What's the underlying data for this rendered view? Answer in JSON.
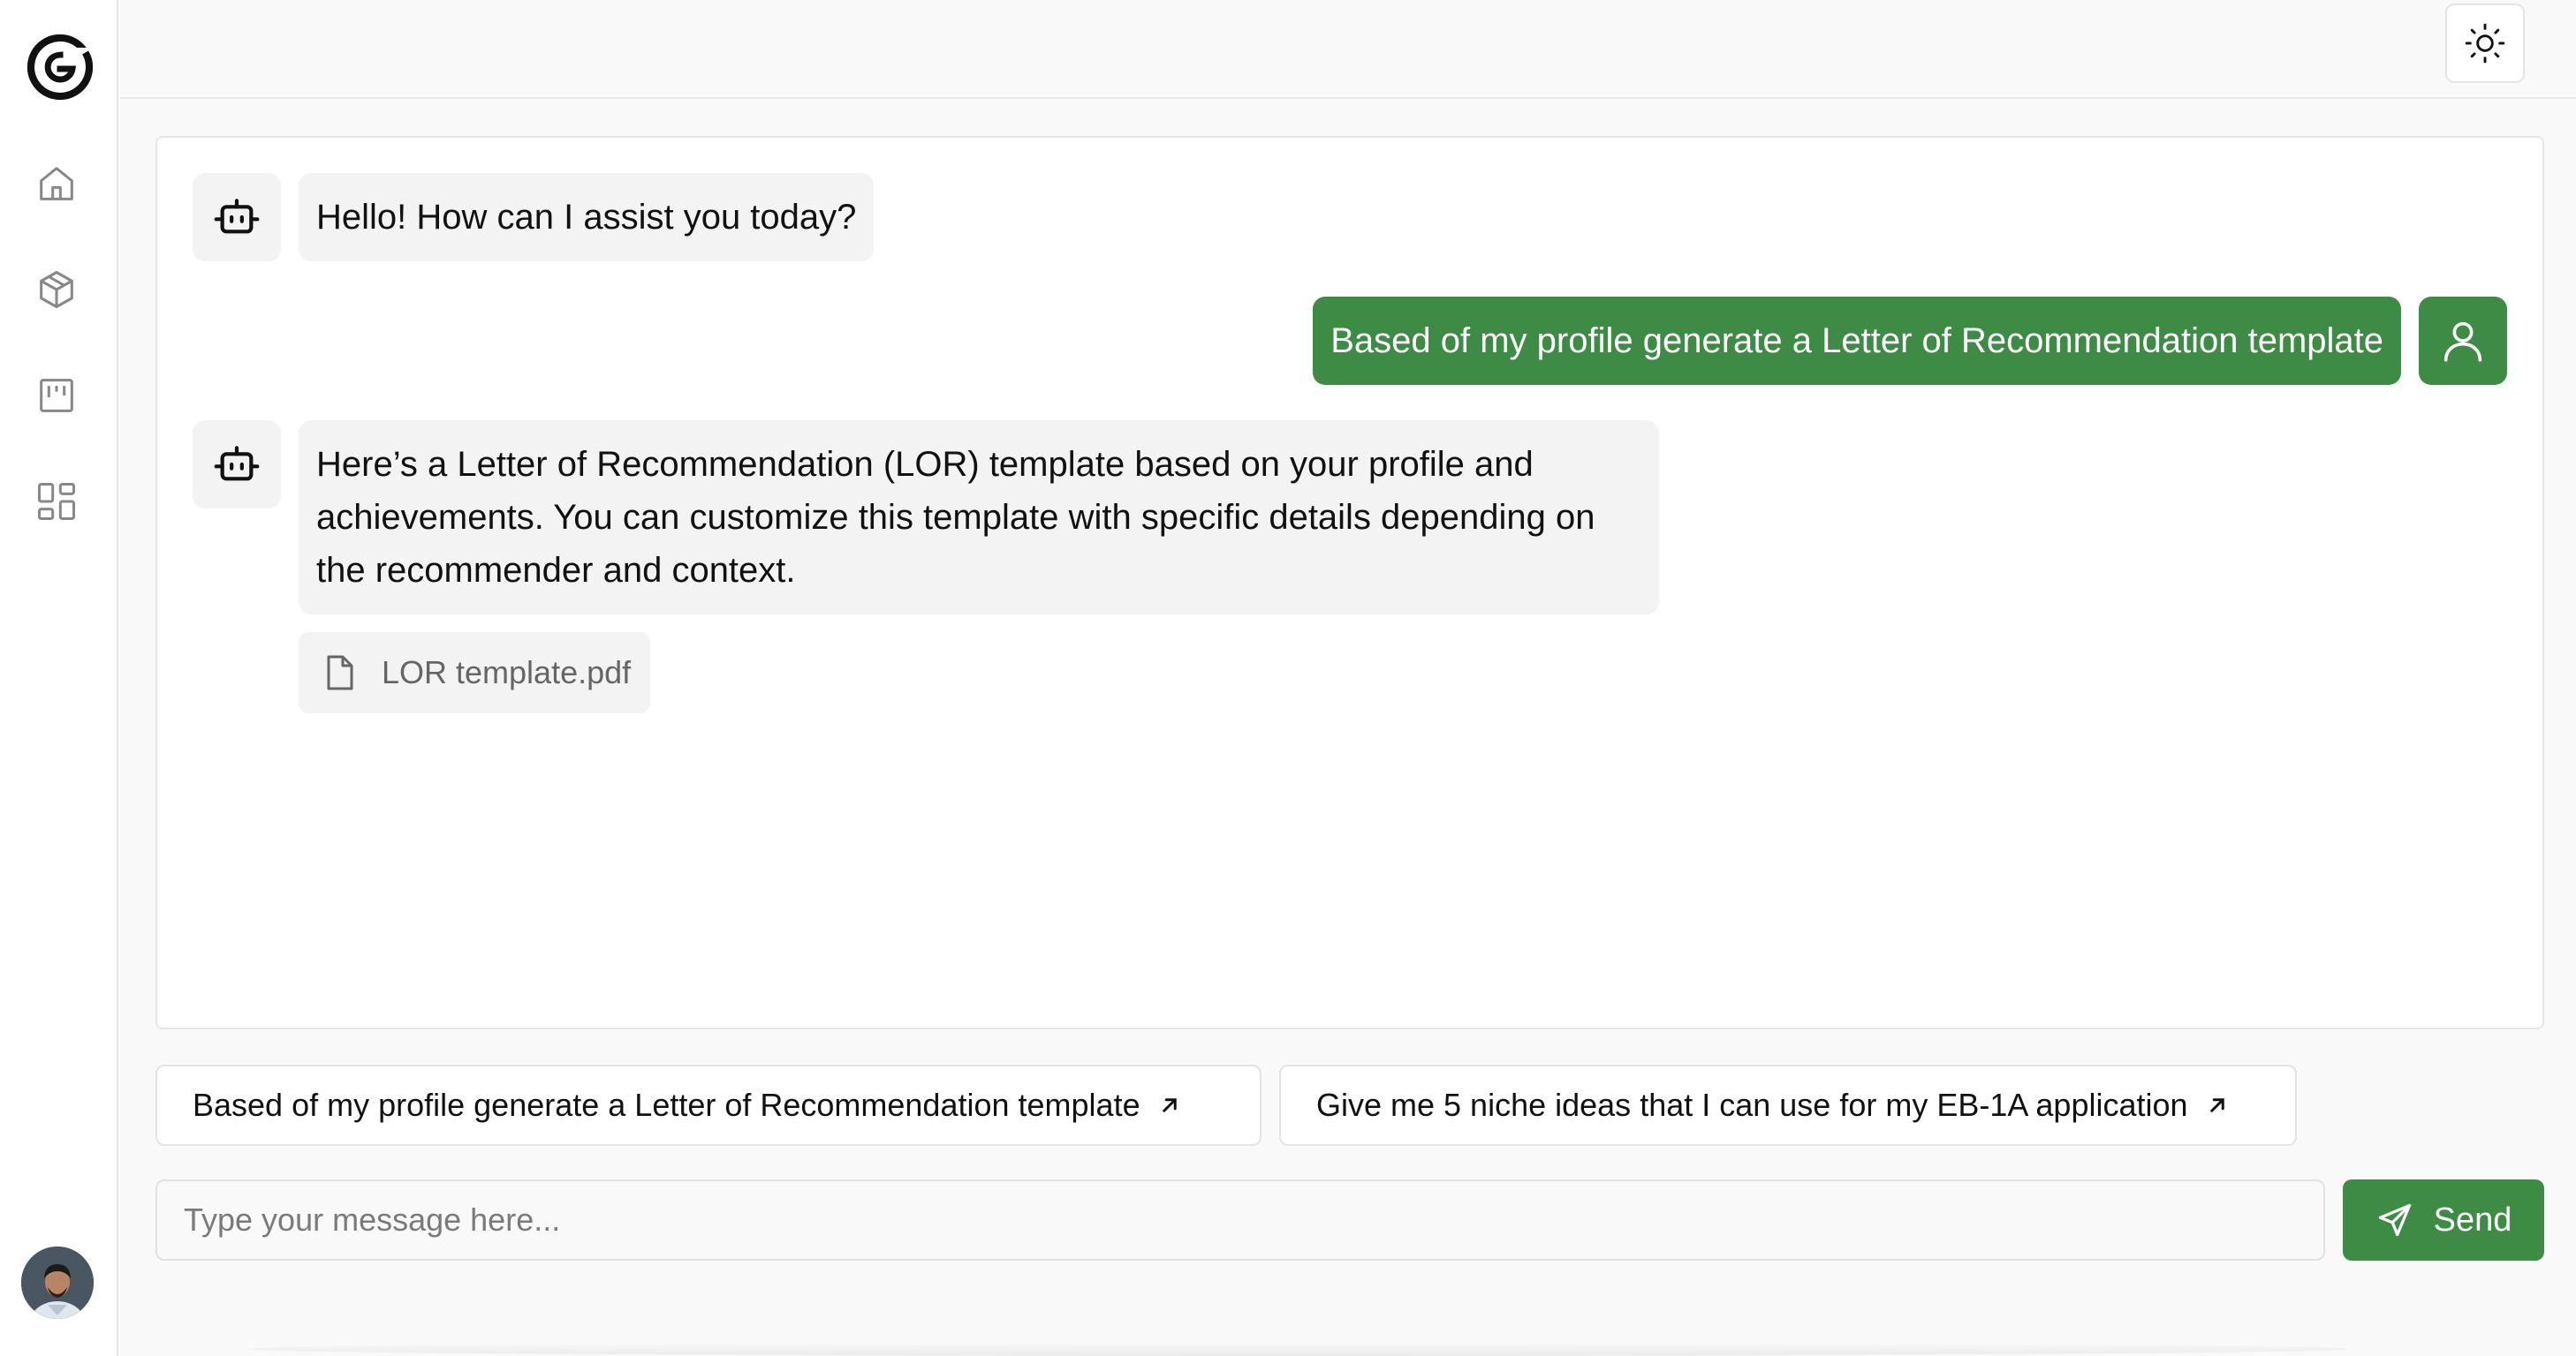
{
  "sidebar": {
    "logo": "g-logo",
    "nav": [
      {
        "icon": "home-icon"
      },
      {
        "icon": "box-icon"
      },
      {
        "icon": "kanban-icon"
      },
      {
        "icon": "dashboard-icon"
      }
    ],
    "avatar": "user-avatar"
  },
  "topbar": {
    "theme_icon": "sun-icon"
  },
  "chat": {
    "messages": [
      {
        "role": "bot",
        "text": "Hello! How can I assist you today?"
      },
      {
        "role": "user",
        "text": "Based of my profile generate a Letter of Recommendation template"
      },
      {
        "role": "bot",
        "text": "Here’s a Letter of Recommendation (LOR) template based on your profile and achievements. You can customize this template with specific details depending on the recommender and context."
      }
    ],
    "attachment": {
      "name": "LOR template.pdf",
      "icon": "file-icon"
    }
  },
  "suggestions": [
    {
      "label": "Based of my profile generate a Letter of Recommendation template"
    },
    {
      "label": "Give me 5 niche ideas that I can use for my EB-1A application"
    }
  ],
  "composer": {
    "placeholder": "Type your message here...",
    "value": "",
    "send_label": "Send"
  },
  "colors": {
    "accent": "#3d8b45",
    "bubble_bg": "#f3f3f3",
    "page_bg": "#f9f9f9"
  }
}
